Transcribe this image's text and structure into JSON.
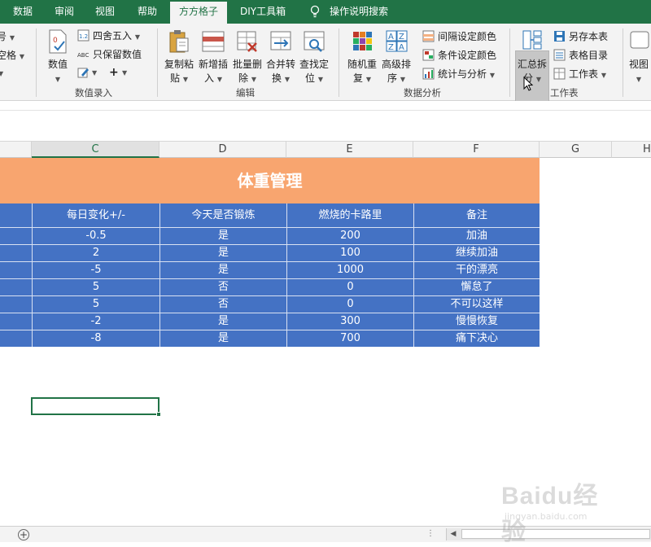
{
  "tabs": [
    {
      "label": "数据",
      "active": false
    },
    {
      "label": "审阅",
      "active": false
    },
    {
      "label": "视图",
      "active": false
    },
    {
      "label": "帮助",
      "active": false
    },
    {
      "label": "方方格子",
      "active": true
    },
    {
      "label": "DIY工具箱",
      "active": false
    }
  ],
  "tell_me": "操作说明搜索",
  "ribbon": {
    "left_partial": [
      "号",
      "空格"
    ],
    "numbers": {
      "big": "数值",
      "round": "四舍五入",
      "keep_numeric": "只保留数值",
      "group": "数值录入"
    },
    "edit": {
      "copy_paste": [
        "复制粘",
        "贴"
      ],
      "insert": [
        "新增插",
        "入"
      ],
      "delete": [
        "批量删",
        "除"
      ],
      "merge": [
        "合并转",
        "换"
      ],
      "locate": [
        "查找定",
        "位"
      ],
      "group": "编辑"
    },
    "analysis": {
      "random": [
        "随机重",
        "复"
      ],
      "sort": [
        "高级排",
        "序"
      ],
      "interval_color": "间隔设定颜色",
      "cond_color": "条件设定颜色",
      "stats": "统计与分析",
      "group": "数据分析"
    },
    "worksheet": {
      "split": [
        "汇总拆",
        "分"
      ],
      "save_as": "另存本表",
      "catalog": "表格目录",
      "worksheet": "工作表",
      "group": "工作表"
    },
    "view_partial": "视图"
  },
  "columns": [
    "C",
    "D",
    "E",
    "F",
    "G",
    "H"
  ],
  "sheet": {
    "title": "体重管理",
    "headers": [
      "每日变化+/-",
      "今天是否锻炼",
      "燃烧的卡路里",
      "备注"
    ],
    "rows": [
      [
        "-0.5",
        "是",
        "200",
        "加油"
      ],
      [
        "2",
        "是",
        "100",
        "继续加油"
      ],
      [
        "-5",
        "是",
        "1000",
        "干的漂亮"
      ],
      [
        "5",
        "否",
        "0",
        "懈怠了"
      ],
      [
        "5",
        "否",
        "0",
        "不可以这样"
      ],
      [
        "-2",
        "是",
        "300",
        "慢慢恢复"
      ],
      [
        "-8",
        "是",
        "700",
        "痛下决心"
      ]
    ]
  },
  "watermark": {
    "brand": "Baidu经验",
    "url": "jingyan.baidu.com"
  },
  "colors": {
    "excel_green": "#217346",
    "title_orange": "#f8a56f",
    "table_blue": "#4472c4"
  }
}
